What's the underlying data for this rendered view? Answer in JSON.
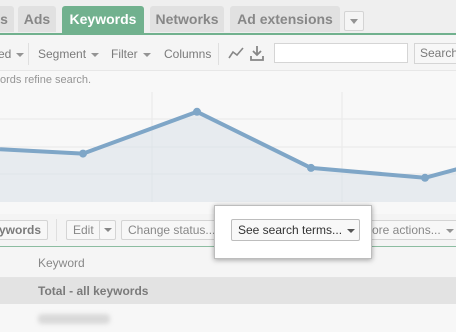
{
  "tabs": [
    {
      "label": "s",
      "active": false
    },
    {
      "label": "Ads",
      "active": false
    },
    {
      "label": "Keywords",
      "active": true
    },
    {
      "label": "Networks",
      "active": false
    },
    {
      "label": "Ad extensions",
      "active": false
    }
  ],
  "toolbar": {
    "partial_label": "ed",
    "segment_label": "Segment",
    "filter_label": "Filter",
    "columns_label": "Columns",
    "search_button": "Search"
  },
  "hint_text": "ords refine search.",
  "chart_data": {
    "type": "line",
    "series": [
      {
        "values": [
          0.48,
          0.44,
          0.82,
          0.31,
          0.22,
          0.33
        ]
      }
    ],
    "color": "#5b8db8",
    "fill": "#cdd9e2",
    "grid": true
  },
  "actions": {
    "keywords_button": "ywords",
    "edit_label": "Edit",
    "change_status_label": "Change status...",
    "see_search_terms_label": "See search terms...",
    "more_actions_label": "More actions..."
  },
  "table": {
    "header_keyword": "Keyword",
    "total_label": "Total - all keywords"
  },
  "colors": {
    "accent": "#4a9b6f",
    "line": "#5b8db8"
  }
}
